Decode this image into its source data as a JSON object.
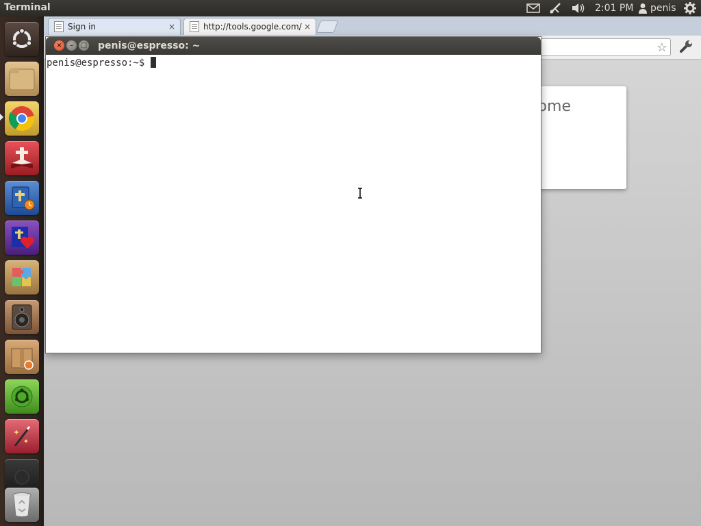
{
  "top_panel": {
    "app_title": "Terminal",
    "clock": "2:01 PM",
    "user": "penis",
    "indicators": [
      "mail-icon",
      "network-icon",
      "volume-icon",
      "user-icon",
      "gear-icon"
    ]
  },
  "launcher": {
    "items": [
      {
        "name": "ubuntu-logo-icon",
        "color": "#3a2e2a"
      },
      {
        "name": "home-folder-icon",
        "color": "#c9a876"
      },
      {
        "name": "chrome-icon",
        "color": "#e2c04a"
      },
      {
        "name": "bible-book-icon",
        "color": "#c0282b"
      },
      {
        "name": "bible-time-icon",
        "color": "#2c5aa0"
      },
      {
        "name": "bible-heart-icon",
        "color": "#6a2b9e"
      },
      {
        "name": "puzzle-icon",
        "color": "#b68a4f"
      },
      {
        "name": "speaker-icon",
        "color": "#a37d5b"
      },
      {
        "name": "package-box-icon",
        "color": "#b48456"
      },
      {
        "name": "ubuntu-software-icon",
        "color": "#5db534"
      },
      {
        "name": "magic-wand-icon",
        "color": "#c8404e"
      },
      {
        "name": "workspaces-icon",
        "color": "#2a2a2a"
      },
      {
        "name": "trash-icon",
        "color": "#8a8a8a"
      }
    ]
  },
  "browser": {
    "tabs": [
      {
        "label": "Sign in",
        "close": "×"
      },
      {
        "label": "http://tools.google.com/c",
        "close": "×"
      }
    ],
    "card_text": "rome"
  },
  "terminal": {
    "title": "penis@espresso: ~",
    "prompt": "penis@espresso:~$ ",
    "buttons": {
      "close": "×",
      "min": "–",
      "max": "□"
    }
  }
}
